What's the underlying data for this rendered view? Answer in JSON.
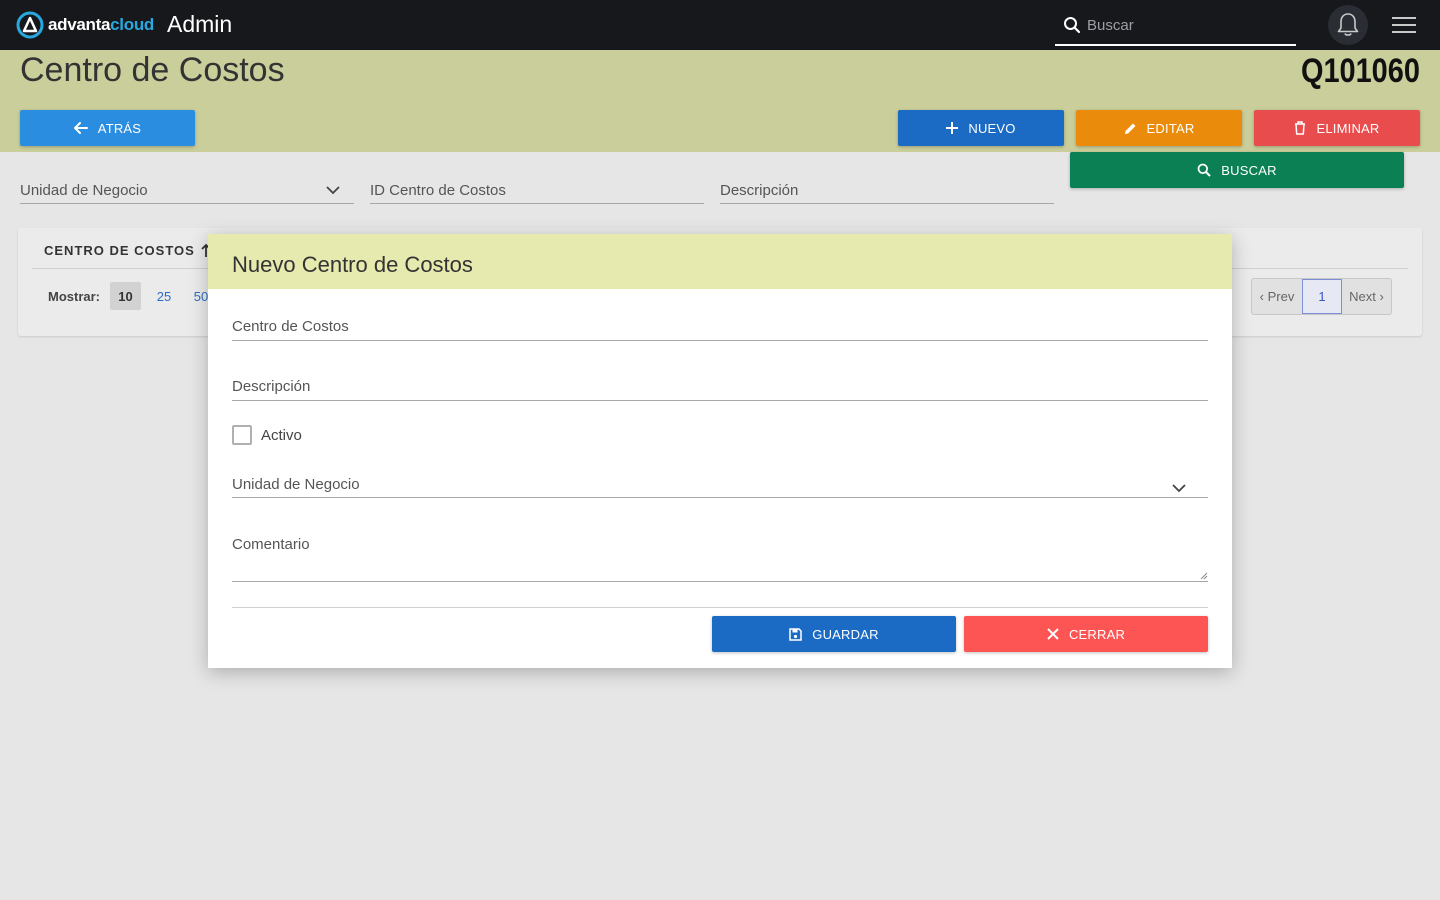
{
  "topbar": {
    "logo_text_1": "advanta",
    "logo_text_2": "cloud",
    "app_title": "Admin",
    "search_placeholder": "Buscar"
  },
  "header": {
    "title": "Centro de Costos",
    "code": "Q101060",
    "back_label": "ATRÁS",
    "new_label": "NUEVO",
    "edit_label": "EDITAR",
    "delete_label": "ELIMINAR",
    "search_label": "BUSCAR"
  },
  "filters": {
    "business_unit": "Unidad de Negocio",
    "cost_center_id": "ID Centro de Costos",
    "description": "Descripción"
  },
  "table": {
    "column_header": "CENTRO DE COSTOS",
    "show_label": "Mostrar:",
    "page_sizes": [
      "10",
      "25",
      "50"
    ],
    "pager": {
      "prev": "‹ Prev",
      "current": "1",
      "next": "Next ›"
    }
  },
  "modal": {
    "title": "Nuevo Centro de Costos",
    "fields": {
      "cost_center": "Centro de Costos",
      "description": "Descripción",
      "active": "Activo",
      "business_unit": "Unidad de Negocio",
      "comment": "Comentario"
    },
    "save_label": "GUARDAR",
    "close_label": "CERRAR"
  },
  "colors": {
    "topbar": "#16181b",
    "header_band": "#c9ce9a",
    "modal_header": "#e7eaaf",
    "btn_back": "#2b8de0",
    "btn_new": "#1b6ac4",
    "btn_edit": "#ea8b0c",
    "btn_delete": "#e84c4c",
    "btn_search": "#0b8055",
    "btn_close": "#fd5454"
  }
}
